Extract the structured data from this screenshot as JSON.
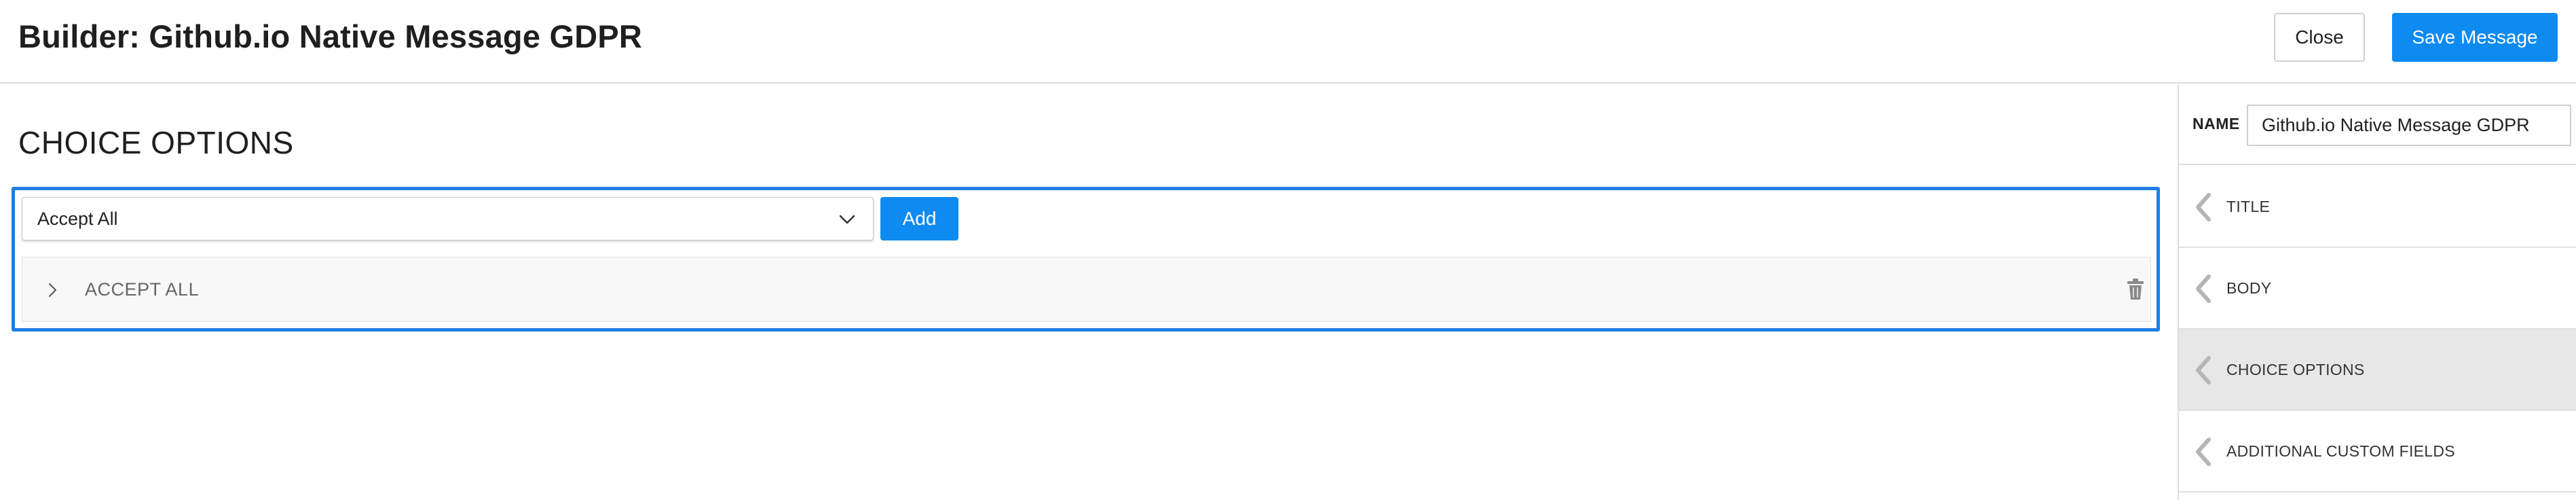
{
  "header": {
    "title": "Builder: Github.io Native Message GDPR",
    "close_label": "Close",
    "save_label": "Save Message"
  },
  "main": {
    "section_title": "CHOICE OPTIONS",
    "select": {
      "value": "Accept All",
      "icon": "chevron-down-icon"
    },
    "add_label": "Add",
    "choices": [
      {
        "label": "ACCEPT ALL",
        "expand_icon": "chevron-right-icon",
        "delete_icon": "trash-icon"
      }
    ]
  },
  "sidebar": {
    "name_label": "NAME",
    "name_value": "Github.io Native Message GDPR",
    "items": [
      {
        "label": "TITLE",
        "active": false
      },
      {
        "label": "BODY",
        "active": false
      },
      {
        "label": "CHOICE OPTIONS",
        "active": true
      },
      {
        "label": "ADDITIONAL CUSTOM FIELDS",
        "active": false
      }
    ]
  },
  "colors": {
    "accent": "#0d8bf0",
    "selection_border": "#1f7fe0",
    "active_item_bg": "#e7e7e7"
  }
}
